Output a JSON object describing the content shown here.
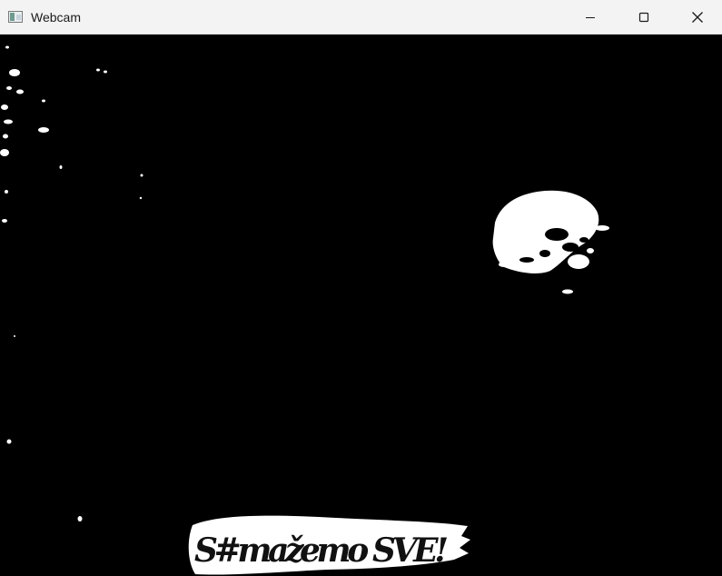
{
  "window": {
    "title": "Webcam",
    "icon": "app-window-icon",
    "controls": {
      "minimize": "minimize-icon",
      "maximize": "maximize-icon",
      "close": "close-icon"
    },
    "background_color": "#000000"
  },
  "titlebar": {
    "background_color": "#f3f3f3"
  },
  "overlay": {
    "banner_text": "S#mažemo SVE!"
  }
}
